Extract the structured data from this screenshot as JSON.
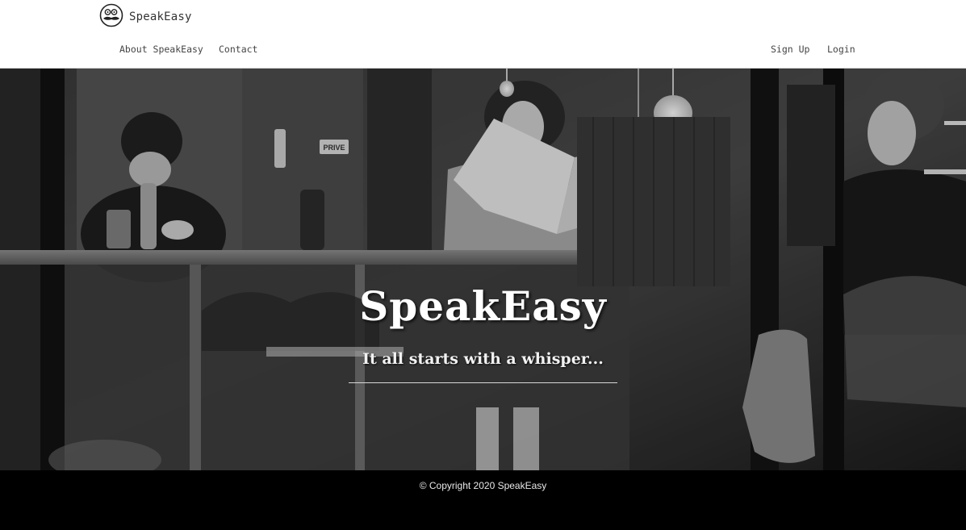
{
  "nav": {
    "brand": "SpeakEasy",
    "brand_icon": "mustache-face-icon",
    "left_links": [
      "About SpeakEasy",
      "Contact"
    ],
    "right_links": [
      "Sign Up",
      "Login"
    ]
  },
  "hero": {
    "title": "SpeakEasy",
    "tagline": "It all starts with a whisper...",
    "background": "black-and-white cafe window photo"
  },
  "footer": {
    "copyright": "© Copyright 2020 SpeakEasy"
  },
  "colors": {
    "navbar_bg": "#ffffff",
    "nav_text": "#444444",
    "hero_text": "#ffffff",
    "footer_bg": "#000000"
  }
}
